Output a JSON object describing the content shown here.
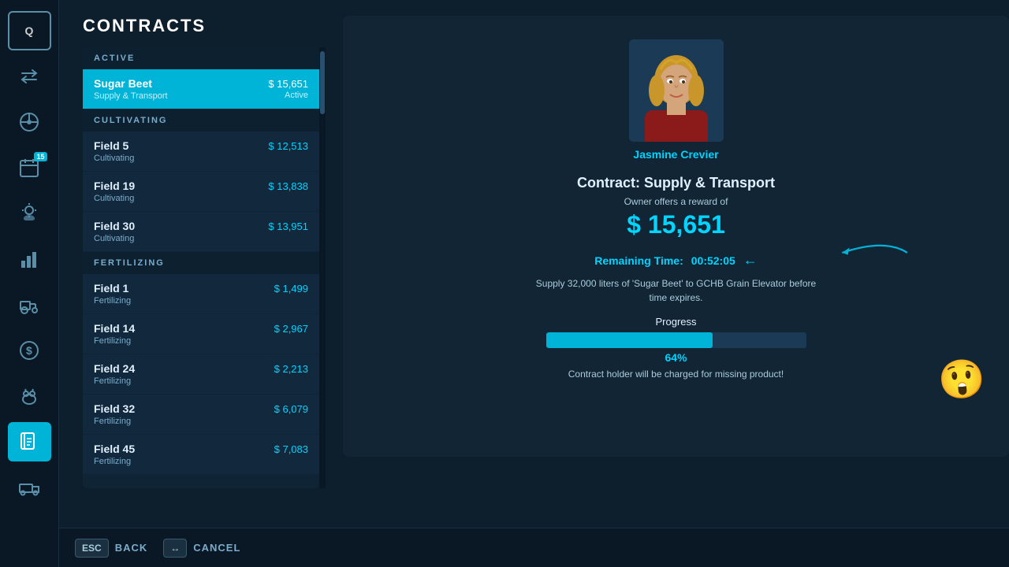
{
  "page": {
    "title": "CONTRACTS"
  },
  "sidebar": {
    "items": [
      {
        "id": "q",
        "label": "Q",
        "icon": "Q",
        "active": false,
        "is_key": true
      },
      {
        "id": "exchange",
        "label": "Exchange",
        "icon": "⇄",
        "active": false
      },
      {
        "id": "steering",
        "label": "Steering",
        "icon": "⊙",
        "active": false
      },
      {
        "id": "calendar",
        "label": "Calendar",
        "icon": "📅",
        "active": false,
        "badge": "15"
      },
      {
        "id": "weather",
        "label": "Weather",
        "icon": "☀",
        "active": false
      },
      {
        "id": "stats",
        "label": "Stats",
        "icon": "📊",
        "active": false
      },
      {
        "id": "tractor",
        "label": "Tractor",
        "icon": "🚜",
        "active": false
      },
      {
        "id": "money",
        "label": "Money",
        "icon": "$",
        "active": false
      },
      {
        "id": "animals",
        "label": "Animals",
        "icon": "🐄",
        "active": false
      },
      {
        "id": "contracts",
        "label": "Contracts",
        "icon": "📋",
        "active": true
      },
      {
        "id": "transport",
        "label": "Transport",
        "icon": "🚛",
        "active": false
      }
    ]
  },
  "contracts": {
    "sections": [
      {
        "id": "active",
        "label": "ACTIVE",
        "items": [
          {
            "id": "sugar-beet",
            "name": "Sugar Beet",
            "sub": "Supply & Transport",
            "price": "$ 15,651",
            "status": "Active",
            "selected": true
          }
        ]
      },
      {
        "id": "cultivating",
        "label": "CULTIVATING",
        "items": [
          {
            "id": "field-5",
            "name": "Field 5",
            "sub": "Cultivating",
            "price": "$ 12,513",
            "status": ""
          },
          {
            "id": "field-19",
            "name": "Field 19",
            "sub": "Cultivating",
            "price": "$ 13,838",
            "status": ""
          },
          {
            "id": "field-30",
            "name": "Field 30",
            "sub": "Cultivating",
            "price": "$ 13,951",
            "status": ""
          }
        ]
      },
      {
        "id": "fertilizing",
        "label": "FERTILIZING",
        "items": [
          {
            "id": "field-1",
            "name": "Field 1",
            "sub": "Fertilizing",
            "price": "$ 1,499",
            "status": ""
          },
          {
            "id": "field-14",
            "name": "Field 14",
            "sub": "Fertilizing",
            "price": "$ 2,967",
            "status": ""
          },
          {
            "id": "field-24",
            "name": "Field 24",
            "sub": "Fertilizing",
            "price": "$ 2,213",
            "status": ""
          },
          {
            "id": "field-32",
            "name": "Field 32",
            "sub": "Fertilizing",
            "price": "$ 6,079",
            "status": ""
          },
          {
            "id": "field-45",
            "name": "Field 45",
            "sub": "Fertilizing",
            "price": "$ 7,083",
            "status": ""
          }
        ]
      }
    ]
  },
  "detail": {
    "npc_name": "Jasmine Crevier",
    "contract_type": "Contract: Supply & Transport",
    "reward_label": "Owner offers a reward of",
    "reward_amount": "$ 15,651",
    "remaining_label": "Remaining Time:",
    "remaining_time": "00:52:05",
    "supply_desc": "Supply 32,000 liters of 'Sugar Beet' to GCHB Grain Elevator before time expires.",
    "progress_label": "Progress",
    "progress_pct": 64,
    "progress_pct_label": "64%",
    "charge_warning": "Contract holder will be charged for missing product!"
  },
  "bottom": {
    "back_key": "ESC",
    "back_label": "BACK",
    "cancel_key": "↔",
    "cancel_label": "CANCEL"
  },
  "colors": {
    "accent": "#00d4ff",
    "selected_bg": "#00b4d8",
    "panel_bg": "#122535",
    "sidebar_active": "#00b4d8"
  }
}
